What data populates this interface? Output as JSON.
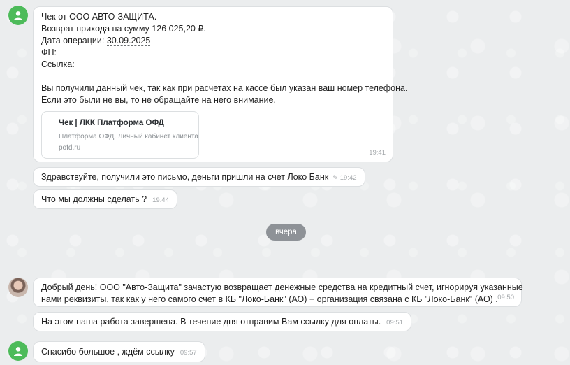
{
  "messages": {
    "receipt": {
      "line1": "Чек от ООО АВТО-ЗАЩИТА.",
      "line2": "Возврат прихода на сумму 126 025,20 ₽.",
      "date_label": "Дата операции: ",
      "date_value": "30.09.2025",
      "fn_label": "ФН:",
      "link_label": "Ссылка:",
      "body1": "Вы получили данный чек, так как при расчетах на кассе был указан ваш номер телефона.",
      "body2": "Если это были не вы, то не обращайте на него внимание.",
      "card_title": "Чек | ЛКК Платформа ОФД",
      "card_desc": "Платформа ОФД. Личный кабинет клиента",
      "card_domain": "pofd.ru",
      "time": "19:41"
    },
    "m2": {
      "text": "Здравствуйте, получили это письмо, деньги пришли на счет Локо Банк",
      "time": "19:42"
    },
    "m3": {
      "text": "Что мы должны сделать ?",
      "time": "19:44"
    },
    "date_separator": "вчера",
    "m4": {
      "line1": "Добрый день! ООО \"Авто-Защита\" зачастую возвращает денежные средства на кредитный счет, игнорируя указанные",
      "line2": "нами реквизиты, так как у него самого счет в КБ \"Локо-Банк\" (АО) + организация связана с КБ \"Локо-Банк\" (АО) .",
      "time": "09:50"
    },
    "m5": {
      "text": "На этом наша работа завершена. В течение дня отправим Вам ссылку для оплаты.",
      "time": "09:51"
    },
    "m6": {
      "text": "Спасибо большое , ждём ссылку",
      "time": "09:57"
    }
  },
  "icons": {
    "user_avatar": "user-icon",
    "edit": "pencil-icon"
  },
  "colors": {
    "avatar_green": "#4dbb5a",
    "date_pill": "#8e9297"
  }
}
